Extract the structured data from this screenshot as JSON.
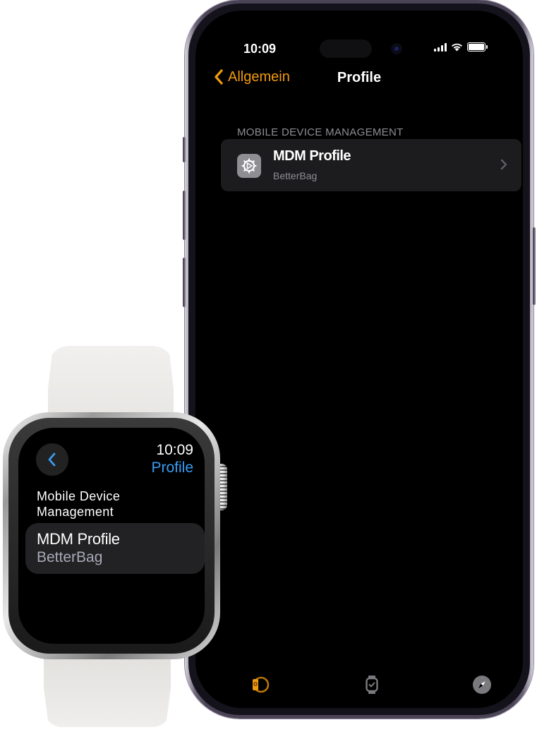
{
  "phone": {
    "status_bar": {
      "time": "10:09",
      "icons": [
        "cellular-signal-icon",
        "wifi-icon",
        "battery-icon"
      ]
    },
    "nav": {
      "back_label": "Allgemein",
      "back_icon": "chevron-left-icon",
      "title": "Profile"
    },
    "section": {
      "header": "MOBILE DEVICE MANAGEMENT",
      "items": [
        {
          "icon": "gear-icon",
          "title": "MDM Profile",
          "subtitle": "BetterBag",
          "accessory": "chevron-right-icon"
        }
      ]
    },
    "tab_bar": {
      "tabs": [
        {
          "icon": "watch-faces-icon",
          "label": "",
          "selected": true
        },
        {
          "icon": "watch-icon",
          "label": "",
          "selected": false
        },
        {
          "icon": "compass-icon",
          "label": "",
          "selected": false
        }
      ]
    },
    "colors": {
      "accent": "#f29a0f",
      "background": "#000000",
      "cell": "#1c1c1e",
      "secondary_text": "#8d8d93"
    }
  },
  "watch": {
    "time": "10:09",
    "title": "Profile",
    "back_icon": "chevron-left-icon",
    "section_header": "Mobile Device Management",
    "items": [
      {
        "title": "MDM Profile",
        "subtitle": "BetterBag"
      }
    ],
    "colors": {
      "accent": "#3a9cf4",
      "cell": "#222224"
    }
  }
}
